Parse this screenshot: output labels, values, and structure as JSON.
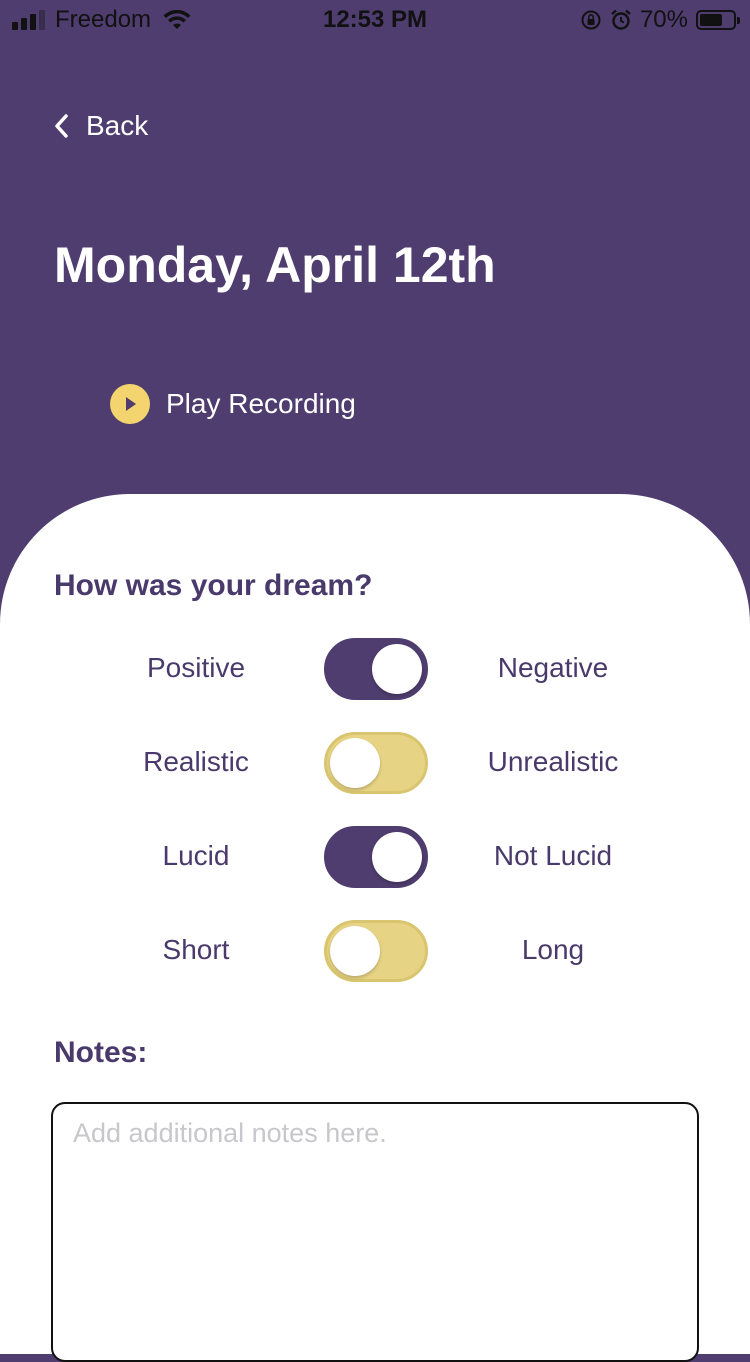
{
  "status_bar": {
    "carrier": "Freedom",
    "time": "12:53 PM",
    "battery_percent": "70%",
    "battery_level": 0.7,
    "signal_bars_active": 3,
    "signal_bars_total": 4
  },
  "header": {
    "back_label": "Back",
    "title": "Monday, April 12th",
    "play_label": "Play Recording"
  },
  "survey": {
    "title": "How was your dream?",
    "toggles": [
      {
        "left": "Positive",
        "right": "Negative",
        "state": "on"
      },
      {
        "left": "Realistic",
        "right": "Unrealistic",
        "state": "off"
      },
      {
        "left": "Lucid",
        "right": "Not Lucid",
        "state": "on"
      },
      {
        "left": "Short",
        "right": "Long",
        "state": "off"
      }
    ]
  },
  "notes": {
    "title": "Notes:",
    "placeholder": "Add additional notes here.",
    "value": ""
  },
  "colors": {
    "header_bg": "#4E3D6E",
    "accent_yellow": "#F3D46E",
    "text_purple": "#4A3A6C"
  }
}
